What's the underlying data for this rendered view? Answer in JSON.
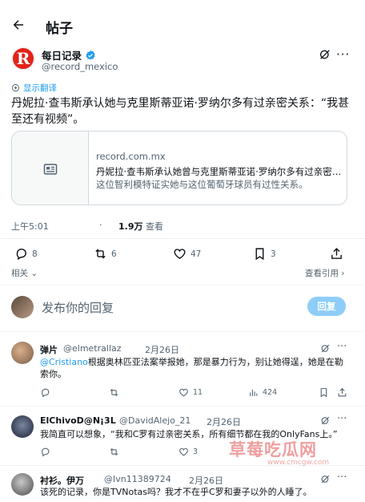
{
  "header": {
    "title": "帖子"
  },
  "post": {
    "author_name": "每日记录",
    "author_handle": "@record_mexico",
    "avatar_letter": "R",
    "show_translation": "显示翻译",
    "text": "丹妮拉·查韦斯承认她与克里斯蒂亚诺·罗纳尔多有过亲密关系：“我甚至还有视频”。",
    "card": {
      "domain": "record.com.mx",
      "title": "丹妮拉·查韦斯承认她曾与克里斯蒂亚诺·罗纳尔多有过亲密关系...",
      "description": "这位智利模特证实她与这位葡萄牙球员有过性关系。"
    },
    "time": "上午5:01",
    "dot": "·",
    "views_count": "1.9万",
    "views_label": "查看",
    "stats": {
      "replies": "8",
      "reposts": "6",
      "likes": "47",
      "bookmarks": "3"
    },
    "related_label": "相关",
    "view_quotes_label": "查看引用"
  },
  "reply_box": {
    "placeholder": "发布你的回复",
    "button_label": "回复"
  },
  "comments": [
    {
      "name": "弹片",
      "handle": "@elmetrallaz",
      "date": "2月26日",
      "mention": "@Cristiano",
      "text": "根据奥林匹亚法案举报她，那是暴力行为，别让她得逞，她是在勒索你。",
      "likes": "11",
      "views": "424"
    },
    {
      "name": "ElChivoD@N¡3L",
      "handle": "@DavidAlejo_21",
      "date": "2月26日",
      "text": "我简直可以想象，“我和C罗有过亲密关系，所有细节都在我的OnlyFans上。”",
      "likes": "3"
    },
    {
      "name": "衬衫。伊万",
      "handle": "@Ivn11389724",
      "date": "2月26日",
      "text": "该死的记录，你是TVNotas吗？我才不在乎C罗和妻子以外的人睡了。"
    }
  ],
  "watermark": {
    "main": "草莓吃瓜网",
    "sub": "www.cmcgw.com"
  }
}
